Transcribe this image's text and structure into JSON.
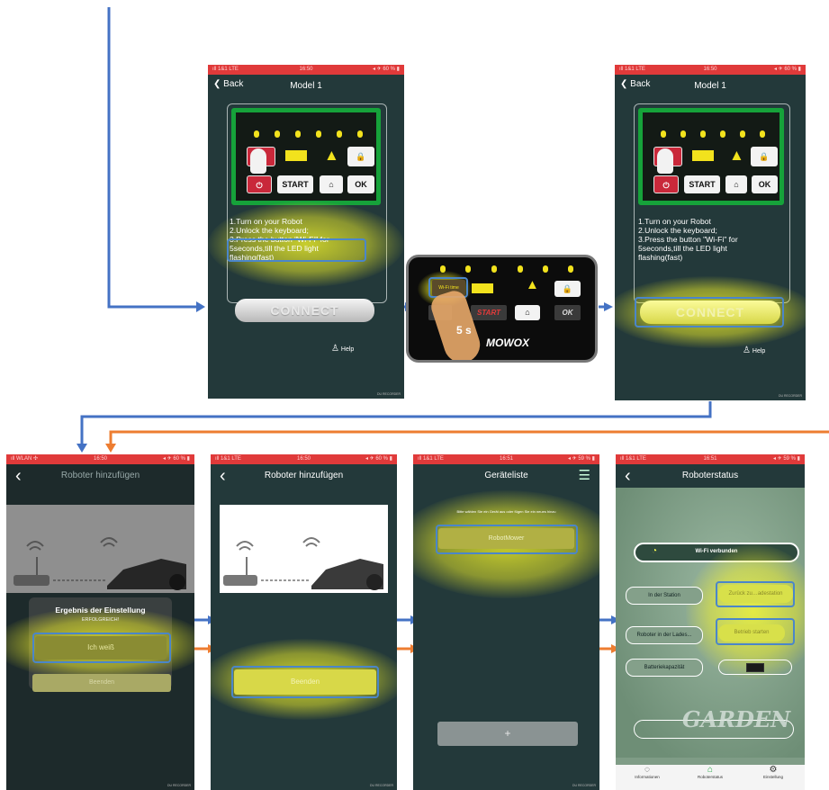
{
  "status_bar": {
    "carrier": "ıll 1&1 LTE",
    "carrier_wlan": "ıll WLAN ✣",
    "time1": "16:50",
    "time2": "16:51",
    "battery": "◂ ✈ 60 % ▮",
    "battery2": "◂ ✈ 59 % ▮"
  },
  "setup": {
    "back_label": "Back",
    "title": "Model 1",
    "instruction_lines": [
      "1.Turn on your Robot",
      "2.Unlock the keyboard;",
      "3.Press the button \"Wi-Fi\" for",
      "5seconds,till the LED light",
      "flashing(fast)"
    ],
    "key_start": "START",
    "key_ok": "OK",
    "connect_label": "CONNECT",
    "help_label": "Help",
    "watermark": "DU RECORDER"
  },
  "keypad_photo": {
    "wifi_time_label": "Wi-Fi time",
    "start_label": "START",
    "ok_label": "OK",
    "press_duration": "5 s",
    "brand": "MOWOX"
  },
  "add_robot": {
    "title": "Roboter hinzufügen",
    "result_title": "Ergebnis der Einstellung",
    "result_status": "ERFOLGREICH!",
    "confirm_button": "Ich weiß",
    "finish_button": "Beenden"
  },
  "device_list": {
    "title": "Geräteliste",
    "hint": "Bitte wählen Sie ein Gerät aus oder fügen Sie ein neues hinzu",
    "device_name": "RobotMower",
    "add_button": "+"
  },
  "robot_status": {
    "title": "Roboterstatus",
    "wifi_status": "Wi-Fi verbunden",
    "in_station": "In der Station",
    "return_station": "Zurück zu…adestation",
    "robot_charging": "Roboter in der Lades...",
    "start_operation": "Betrieb starten",
    "battery_capacity": "Batteriekapazität",
    "garden_sign": "GARDEN",
    "tabs": [
      "Informationen",
      "Roboterstatus",
      "Einstellung"
    ]
  },
  "colors": {
    "app_bg": "#23393a",
    "status_bar": "#e03a3a",
    "flow_blue": "#4472c4",
    "flow_orange": "#ed7d31",
    "highlight": "#f4f42a",
    "panel_green": "#16a23a"
  }
}
